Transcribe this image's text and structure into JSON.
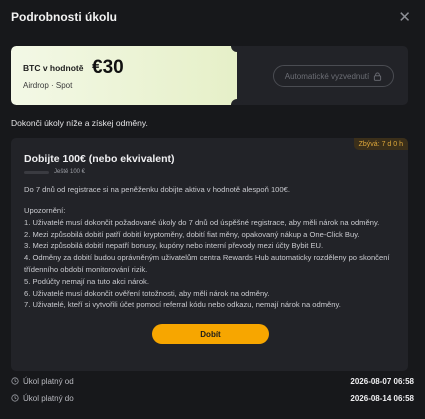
{
  "dialog": {
    "title": "Podrobnosti úkolu",
    "close_icon": "close-icon"
  },
  "voucher": {
    "label": "BTC v hodnotě",
    "amount": "€30",
    "subtitle": "Airdrop · Spot",
    "auto_claim_label": "Automatické vyzvednutí",
    "auto_claim_icon": "lock-icon",
    "ticket_color": "#eaf3d3"
  },
  "intro_text": "Dokonči úkoly níže a získej odměny.",
  "task": {
    "badge": "Zbývá: 7 d 0 h",
    "title": "Dobijte 100€ (nebo ekvivalent)",
    "progress_text": "Ještě 100 €",
    "progress_fraction": 0,
    "description": "Do 7 dnů od registrace si na peněženku dobijte aktiva v hodnotě alespoň 100€.",
    "notes": [
      "Upozornění:",
      "1. Uživatelé musí dokončit požadované úkoly do 7 dnů od úspěšné registrace, aby měli nárok na odměny.",
      "2. Mezi způsobilá dobití patří dobití kryptoměny, dobití fiat měny, opakovaný nákup a One-Click Buy.",
      "3. Mezi způsobilá dobití nepatří bonusy, kupóny nebo interní převody mezi účty Bybit EU.",
      "4. Odměny za dobití budou oprávněným uživatelům centra Rewards Hub automaticky rozděleny po skončení třídenního období monitorování rizik.",
      "5. Podúčty nemají na tuto akci nárok.",
      "6. Uživatelé musí dokončit ověření totožnosti, aby měli nárok na odměny.",
      "7. Uživatelé, kteří si vytvořili účet pomocí referral kódu nebo odkazu, nemají nárok na odměny."
    ],
    "button_label": "Dobít",
    "accent": "#f7a600"
  },
  "validity": {
    "from_label": "Úkol platný od",
    "from_value": "2026-08-07 06:58",
    "to_label": "Úkol platný do",
    "to_value": "2026-08-14 06:58"
  }
}
